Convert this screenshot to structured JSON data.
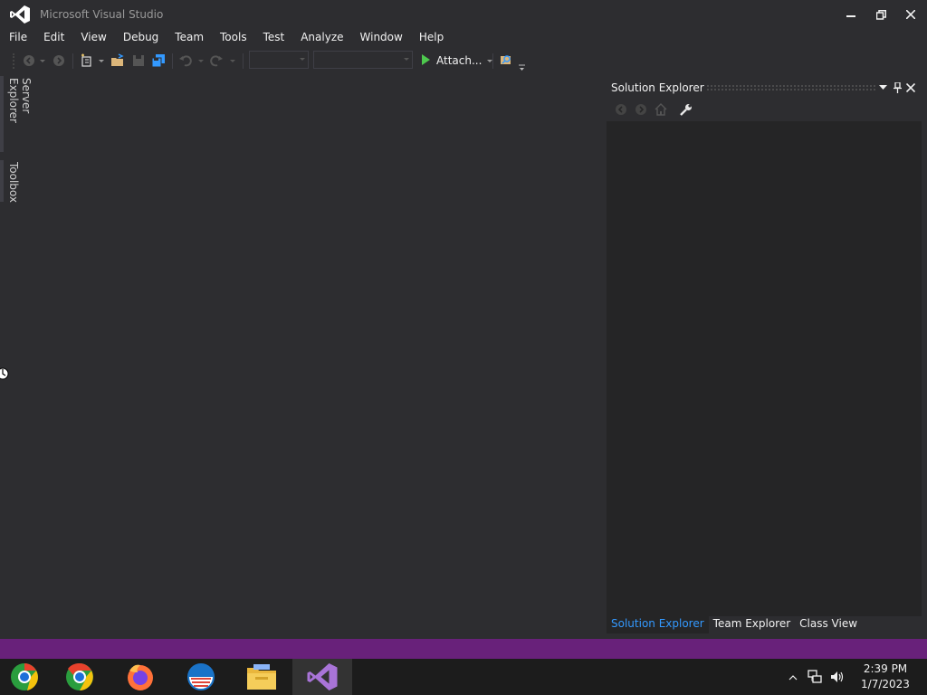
{
  "window": {
    "title": "Microsoft Visual Studio",
    "controls": {
      "minimize": "—",
      "restore": "❐",
      "close": "✕"
    }
  },
  "menu": [
    "File",
    "Edit",
    "View",
    "Debug",
    "Team",
    "Tools",
    "Test",
    "Analyze",
    "Window",
    "Help"
  ],
  "toolbar": {
    "attach_label": "Attach...",
    "icons": [
      "back-arrow-icon",
      "forward-arrow-icon",
      "new-project-icon",
      "open-file-icon",
      "save-icon",
      "save-all-icon",
      "undo-icon",
      "redo-icon",
      "run-triangle-icon",
      "find-icon"
    ]
  },
  "left_tabs": {
    "server_explorer": "Server Explorer",
    "toolbox": "Toolbox"
  },
  "solution_explorer": {
    "title": "Solution Explorer",
    "bottom_tabs": [
      {
        "label": "Solution Explorer",
        "active": true
      },
      {
        "label": "Team Explorer",
        "active": false
      },
      {
        "label": "Class View",
        "active": false
      }
    ]
  },
  "taskbar": {
    "apps": [
      "chromium-icon",
      "chrome-icon",
      "firefox-icon",
      "outlook-icon",
      "file-explorer-icon",
      "visual-studio-icon"
    ],
    "clock": {
      "time": "2:39 PM",
      "date": "1/7/2023"
    }
  },
  "colors": {
    "accent": "#68217a",
    "active_tab": "#3399ff",
    "background": "#2d2d30"
  }
}
